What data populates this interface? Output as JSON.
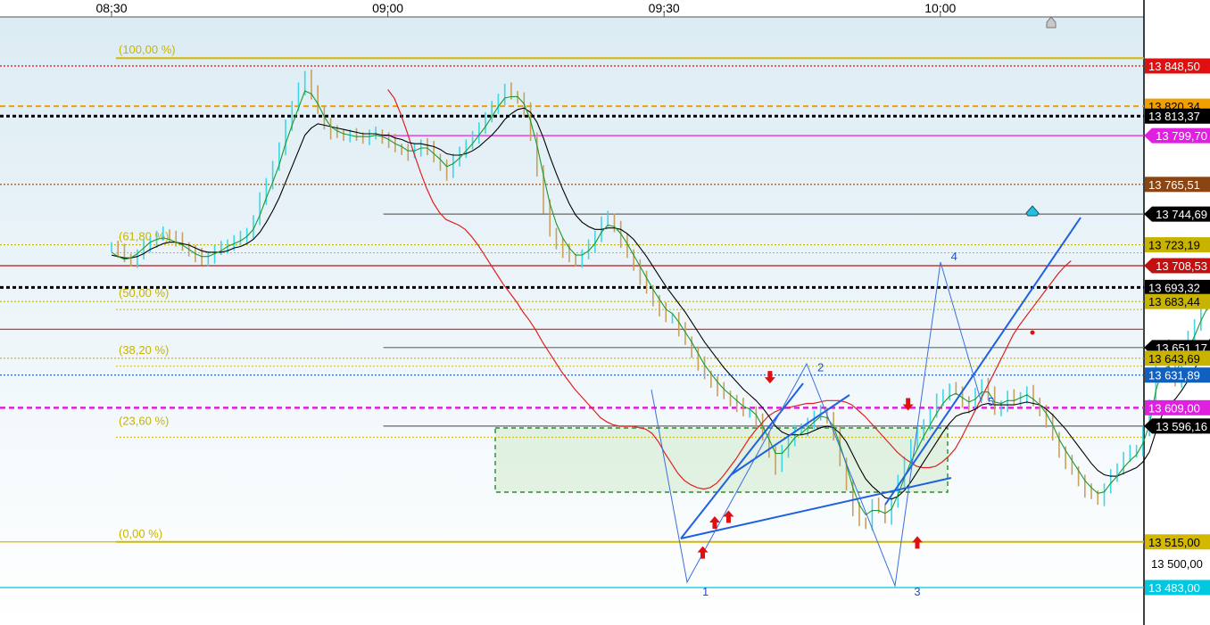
{
  "chart_data": {
    "type": "line",
    "instrument_chart": "intraday candlestick with moving averages, Fibonacci retracement and Elliott wave count",
    "x_axis": {
      "ticks": [
        "08:30",
        "09:00",
        "09:30",
        "10:00"
      ],
      "position": "top"
    },
    "y_axis": {
      "position": "right",
      "range": [
        13460,
        13870
      ],
      "unlabeled_ticks": [
        "13 500,00"
      ]
    },
    "colors": {
      "bull": "#3fd6e6",
      "bear": "#c8a060",
      "fast_ma": "#1a9a2a",
      "mid_ma": "#000000",
      "slow_ma": "#e02020",
      "wave": "#3a6fe0"
    },
    "price_levels": [
      {
        "label": "13 848,50",
        "value": 13848.5,
        "color": "#e01010",
        "style": "dotted",
        "tag": "boxed"
      },
      {
        "label": "13 820,34",
        "value": 13820.34,
        "color": "#f0a000",
        "style": "dashed",
        "tag": "boxed"
      },
      {
        "label": "13 813,37",
        "value": 13813.37,
        "color": "#000000",
        "style": "thick-dotted",
        "tag": "boxed"
      },
      {
        "label": "13 799,70",
        "value": 13799.7,
        "color": "#e020e0",
        "style": "solid",
        "tag": "arrow",
        "x_start_min": 30
      },
      {
        "label": "13 765,51",
        "value": 13765.51,
        "color": "#8b4513",
        "style": "dotted",
        "tag": "boxed"
      },
      {
        "label": "13 744,69",
        "value": 13744.69,
        "color": "#666666",
        "style": "solid",
        "tag": "arrow",
        "x_start_min": 30
      },
      {
        "label": "13 723,19",
        "value": 13723.19,
        "color": "#c8b400",
        "style": "dotted",
        "tag": "boxed"
      },
      {
        "label": "13 708,53",
        "value": 13708.53,
        "color": "#c01010",
        "style": "solid",
        "tag": "arrow"
      },
      {
        "label": "13 693,32",
        "value": 13693.32,
        "color": "#000000",
        "style": "thick-dotted",
        "tag": "boxed"
      },
      {
        "label": "13 683,44",
        "value": 13683.44,
        "color": "#c8b400",
        "style": "dotted",
        "tag": "boxed"
      },
      {
        "label": "",
        "value": 13664,
        "color": "#d02020",
        "style": "solid",
        "tag": "none"
      },
      {
        "label": "13 651,17",
        "value": 13651.17,
        "color": "#666666",
        "style": "solid",
        "tag": "arrow",
        "x_start_min": 30
      },
      {
        "label": "13 643,69",
        "value": 13643.69,
        "color": "#c8b400",
        "style": "dotted",
        "tag": "boxed"
      },
      {
        "label": "13 631,89",
        "value": 13631.89,
        "color": "#1060c0",
        "style": "dotted",
        "tag": "boxed"
      },
      {
        "label": "13 609,00",
        "value": 13609.0,
        "color": "#e020e0",
        "style": "dashed",
        "tag": "boxed"
      },
      {
        "label": "13 596,16",
        "value": 13596.16,
        "color": "#666666",
        "style": "solid",
        "tag": "arrow",
        "x_start_min": 30
      },
      {
        "label": "13 515,00",
        "value": 13515.0,
        "color": "#d4b800",
        "style": "solid",
        "tag": "boxed"
      },
      {
        "label": "13 483,00",
        "value": 13483.0,
        "color": "#00c8e0",
        "style": "solid",
        "tag": "boxed"
      }
    ],
    "fibonacci": [
      {
        "label": "(100,00 %)",
        "value": 13854
      },
      {
        "label": "(61,80 %)",
        "value": 13723.19
      },
      {
        "label": "(50,00 %)",
        "value": 13683.44
      },
      {
        "label": "(38,20 %)",
        "value": 13643.69
      },
      {
        "label": "(23,60 %)",
        "value": 13594
      },
      {
        "label": "(0,00 %)",
        "value": 13515
      }
    ],
    "wave_labels": [
      {
        "text": "1",
        "t_min": 64.5,
        "price": 13483
      },
      {
        "text": "2",
        "t_min": 77,
        "price": 13640
      },
      {
        "text": "3",
        "t_min": 87.5,
        "price": 13483
      },
      {
        "text": "4",
        "t_min": 91.5,
        "price": 13718
      },
      {
        "text": "5",
        "t_min": 95.5,
        "price": 13616
      }
    ],
    "price_series": {
      "t_start_min": 0,
      "t_step_min": 0.7,
      "values": [
        13722,
        13719,
        13714,
        13712,
        13716,
        13722,
        13726,
        13729,
        13731,
        13729,
        13727,
        13722,
        13719,
        13716,
        13712,
        13715,
        13719,
        13721,
        13724,
        13726,
        13728,
        13732,
        13740,
        13755,
        13767,
        13778,
        13790,
        13808,
        13820,
        13832,
        13842,
        13830,
        13818,
        13808,
        13802,
        13801,
        13800,
        13800,
        13799,
        13798,
        13800,
        13801,
        13798,
        13796,
        13791,
        13790,
        13787,
        13789,
        13794,
        13791,
        13784,
        13779,
        13773,
        13782,
        13789,
        13793,
        13798,
        13806,
        13812,
        13819,
        13826,
        13832,
        13828,
        13826,
        13818,
        13799,
        13775,
        13750,
        13732,
        13724,
        13719,
        13714,
        13712,
        13716,
        13722,
        13730,
        13739,
        13742,
        13736,
        13726,
        13717,
        13709,
        13700,
        13692,
        13684,
        13678,
        13672,
        13672,
        13664,
        13656,
        13648,
        13640,
        13632,
        13627,
        13622,
        13618,
        13614,
        13611,
        13606,
        13606,
        13600,
        13589,
        13578,
        13567,
        13578,
        13587,
        13593,
        13593,
        13599,
        13603,
        13606,
        13602,
        13591,
        13571,
        13555,
        13538,
        13529,
        13528,
        13541,
        13538,
        13532,
        13542,
        13557,
        13572,
        13583,
        13590,
        13598,
        13605,
        13614,
        13619,
        13622,
        13621,
        13613,
        13610,
        13618,
        13626,
        13619,
        13607,
        13611,
        13617,
        13614,
        13617,
        13620,
        13613,
        13607,
        13600,
        13589,
        13578,
        13571,
        13565,
        13558,
        13551,
        13548,
        13545,
        13552,
        13561,
        13567,
        13574,
        13578,
        13580,
        13592,
        13610,
        13645,
        13652,
        13640,
        13628,
        13651,
        13658,
        13668,
        13680,
        13688,
        13686,
        13694,
        13694,
        13690,
        13679,
        13687,
        13707,
        13726,
        13738,
        13745,
        13734,
        13724,
        13717
      ]
    },
    "fast_ma": {
      "t_start_min": 0,
      "t_step_min": 0.7,
      "values": [
        13718,
        13715,
        13713,
        13714,
        13717,
        13721,
        13725,
        13727,
        13728,
        13727,
        13725,
        13723,
        13720,
        13717,
        13715,
        13715,
        13717,
        13719,
        13722,
        13724,
        13726,
        13729,
        13734,
        13744,
        13756,
        13767,
        13779,
        13794,
        13807,
        13819,
        13831,
        13829,
        13822,
        13813,
        13806,
        13803,
        13801,
        13800,
        13799,
        13799,
        13799,
        13800,
        13799,
        13797,
        13794,
        13792,
        13789,
        13789,
        13791,
        13791,
        13787,
        13783,
        13778,
        13780,
        13784,
        13789,
        13794,
        13800,
        13806,
        13813,
        13820,
        13826,
        13827,
        13827,
        13822,
        13810,
        13793,
        13772,
        13752,
        13738,
        13728,
        13721,
        13716,
        13716,
        13719,
        13724,
        13732,
        13737,
        13736,
        13731,
        13724,
        13716,
        13708,
        13700,
        13692,
        13685,
        13678,
        13675,
        13669,
        13662,
        13655,
        13647,
        13639,
        13633,
        13627,
        13622,
        13618,
        13614,
        13610,
        13608,
        13604,
        13596,
        13587,
        13577,
        13577,
        13582,
        13588,
        13591,
        13595,
        13599,
        13603,
        13602,
        13596,
        13583,
        13569,
        13553,
        13541,
        13534,
        13537,
        13537,
        13535,
        13538,
        13548,
        13560,
        13571,
        13580,
        13589,
        13597,
        13605,
        13612,
        13617,
        13619,
        13616,
        13613,
        13615,
        13620,
        13620,
        13613,
        13612,
        13614,
        13614,
        13616,
        13618,
        13615,
        13611,
        13605,
        13597,
        13587,
        13579,
        13572,
        13565,
        13558,
        13553,
        13549,
        13550,
        13556,
        13561,
        13567,
        13572,
        13576,
        13584,
        13597,
        13621,
        13636,
        13638,
        13633,
        13642,
        13650,
        13659,
        13670,
        13679,
        13683,
        13689,
        13692,
        13691,
        13685,
        13686,
        13697,
        13712,
        13725,
        13735,
        13734,
        13729,
        13723
      ]
    },
    "mid_ma": {
      "t_start_min": 0,
      "t_step_min": 0.7,
      "values": [
        13716,
        13715,
        13714,
        13714,
        13715,
        13717,
        13720,
        13722,
        13724,
        13725,
        13725,
        13724,
        13723,
        13721,
        13719,
        13718,
        13718,
        13718,
        13719,
        13721,
        13722,
        13724,
        13727,
        13732,
        13739,
        13747,
        13756,
        13767,
        13778,
        13789,
        13800,
        13805,
        13808,
        13807,
        13806,
        13805,
        13804,
        13803,
        13802,
        13801,
        13801,
        13801,
        13800,
        13800,
        13798,
        13797,
        13795,
        13794,
        13794,
        13793,
        13792,
        13790,
        13787,
        13786,
        13786,
        13787,
        13789,
        13792,
        13796,
        13800,
        13805,
        13811,
        13815,
        13818,
        13819,
        13816,
        13809,
        13798,
        13785,
        13773,
        13762,
        13752,
        13744,
        13739,
        13736,
        13734,
        13734,
        13735,
        13735,
        13734,
        13731,
        13727,
        13721,
        13715,
        13708,
        13701,
        13694,
        13688,
        13682,
        13676,
        13669,
        13662,
        13655,
        13649,
        13643,
        13637,
        13632,
        13627,
        13622,
        13618,
        13614,
        13609,
        13603,
        13596,
        13592,
        13590,
        13590,
        13590,
        13591,
        13593,
        13595,
        13596,
        13595,
        13591,
        13585,
        13576,
        13567,
        13559,
        13554,
        13550,
        13546,
        13545,
        13547,
        13551,
        13557,
        13564,
        13571,
        13578,
        13585,
        13592,
        13598,
        13603,
        13605,
        13606,
        13608,
        13611,
        13612,
        13611,
        13611,
        13611,
        13611,
        13612,
        13613,
        13612,
        13611,
        13608,
        13604,
        13599,
        13594,
        13588,
        13582,
        13576,
        13570,
        13565,
        13562,
        13561,
        13561,
        13563,
        13565,
        13567,
        13571,
        13578,
        13592,
        13604,
        13611,
        13615,
        13621,
        13628,
        13636,
        13645,
        13654,
        13661,
        13668,
        13674,
        13678,
        13679,
        13681,
        13687,
        13696,
        13705,
        13714,
        13718,
        13720,
        13720
      ]
    },
    "slow_ma": {
      "t_start_min": 30,
      "t_step_min": 0.7,
      "values": [
        13832,
        13826,
        13815,
        13802,
        13788,
        13775,
        13763,
        13753,
        13746,
        13741,
        13739,
        13737,
        13734,
        13729,
        13723,
        13716,
        13709,
        13702,
        13695,
        13689,
        13683,
        13676,
        13670,
        13663,
        13655,
        13648,
        13641,
        13634,
        13628,
        13622,
        13617,
        13612,
        13607,
        13602,
        13599,
        13597,
        13596,
        13596,
        13596,
        13595,
        13594,
        13591,
        13585,
        13577,
        13570,
        13563,
        13558,
        13555,
        13553,
        13552,
        13553,
        13556,
        13561,
        13567,
        13573,
        13580,
        13587,
        13593,
        13598,
        13603,
        13606,
        13608,
        13609,
        13610,
        13611,
        13612,
        13612,
        13613,
        13614,
        13614,
        13614,
        13613,
        13611,
        13607,
        13603,
        13598,
        13593,
        13588,
        13583,
        13578,
        13574,
        13571,
        13568,
        13567,
        13567,
        13568,
        13571,
        13575,
        13580,
        13588,
        13597,
        13606,
        13615,
        13624,
        13633,
        13642,
        13651,
        13660,
        13667,
        13673,
        13679,
        13685,
        13691,
        13697,
        13703,
        13708,
        13712
      ]
    },
    "markers": [
      {
        "type": "sell",
        "t_min": 71.5,
        "price": 13631
      },
      {
        "type": "sell",
        "t_min": 86.5,
        "price": 13612
      },
      {
        "type": "buy",
        "t_min": 64.2,
        "price": 13507
      },
      {
        "type": "buy",
        "t_min": 65.5,
        "price": 13528
      },
      {
        "type": "buy",
        "t_min": 67,
        "price": 13532
      },
      {
        "type": "buy",
        "t_min": 87.5,
        "price": 13514
      }
    ]
  }
}
